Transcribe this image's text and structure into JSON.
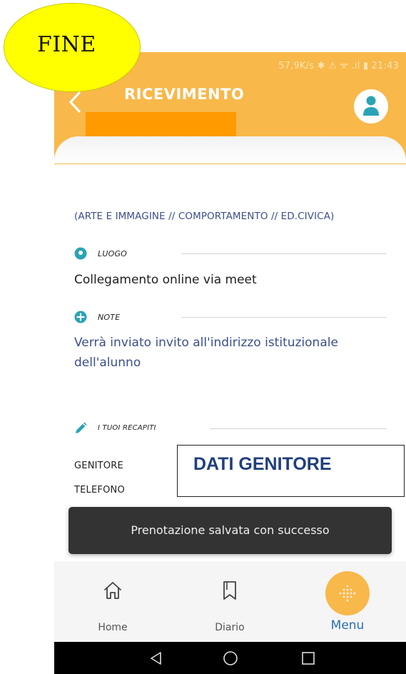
{
  "annotation": {
    "label": "FINE",
    "color": "#ffff00"
  },
  "status_bar": {
    "text": "57,9K/s ✱ ⚠ ᯤ .ıl ▮ 21:43"
  },
  "header": {
    "title": "RICEVIMENTO",
    "back_icon": "chevron-left-icon",
    "avatar_icon": "user-icon",
    "color": "#f8b84a",
    "redaction_color": "#ff9a00"
  },
  "content": {
    "subjects": "(ARTE E IMMAGINE // COMPORTAMENTO // ED.CIVICA)",
    "luogo": {
      "label": "LUOGO",
      "icon": "map-pin-icon",
      "value": "Collegamento online via meet"
    },
    "note": {
      "label": "NOTE",
      "icon": "plus-circle-icon",
      "value": "Verrà  inviato invito all'indirizzo istituzionale dell'alunno"
    },
    "recapiti": {
      "label": "I TUOI RECAPITI",
      "icon": "pencil-icon"
    },
    "genitore_label": "GENITORE",
    "telefono_label": "TELEFONO",
    "dati_overlay": "DATI GENITORE",
    "accent": "#2ba3b5"
  },
  "toast": {
    "message": "Prenotazione salvata con successo"
  },
  "bottom_nav": {
    "items": [
      {
        "label": "Home",
        "icon": "home-icon"
      },
      {
        "label": "Diario",
        "icon": "bookmark-icon"
      },
      {
        "label": "Menu",
        "icon": "grid-dots-icon",
        "active": true
      }
    ],
    "active_color": "#2a6db8"
  },
  "system_nav": {
    "back": "triangle-back-icon",
    "home": "circle-home-icon",
    "recents": "square-recents-icon"
  }
}
